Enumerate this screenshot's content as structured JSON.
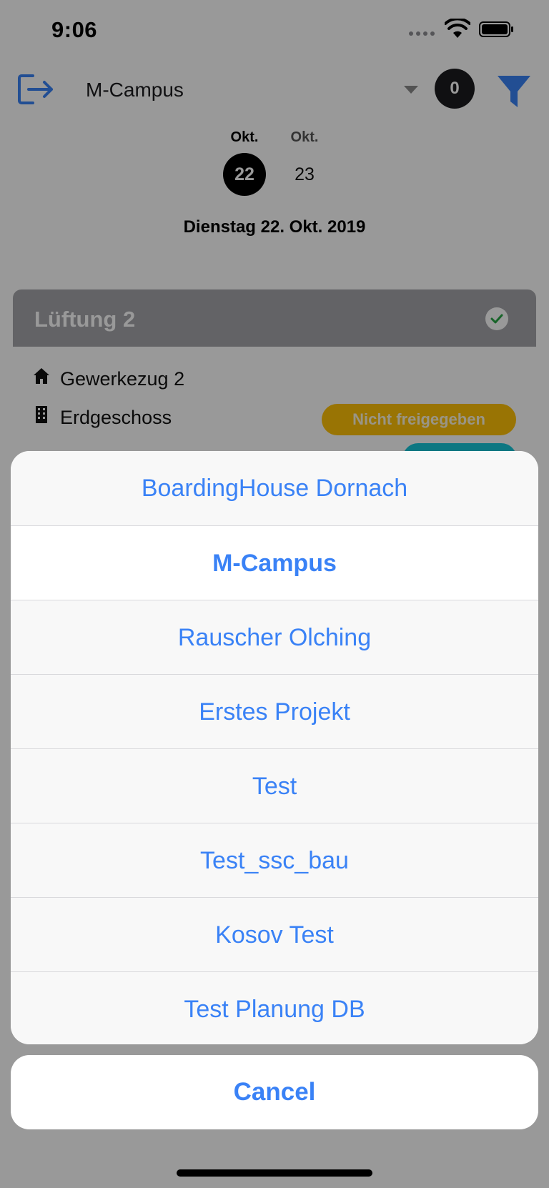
{
  "status_bar": {
    "time": "9:06"
  },
  "header": {
    "project_select_value": "M-Campus",
    "notification_count": "0",
    "dates": [
      {
        "month": "Okt.",
        "day": "22",
        "selected": true
      },
      {
        "month": "Okt.",
        "day": "23",
        "selected": false
      }
    ],
    "selected_date_label": "Dienstag 22. Okt. 2019"
  },
  "task_card": {
    "title": "Lüftung 2",
    "rows": [
      {
        "icon": "home-icon",
        "text": "Gewerkezug 2"
      },
      {
        "icon": "building-icon",
        "text": "Erdgeschoss"
      }
    ],
    "status_label": "Nicht freigegeben",
    "colors": {
      "header": "#a5a6ab",
      "status_pending": "#ffc107",
      "status_secondary": "#17c6d9"
    }
  },
  "action_sheet": {
    "options": [
      {
        "label": "BoardingHouse Dornach",
        "selected": false
      },
      {
        "label": "M-Campus",
        "selected": true
      },
      {
        "label": "Rauscher Olching",
        "selected": false
      },
      {
        "label": "Erstes Projekt",
        "selected": false
      },
      {
        "label": "Test",
        "selected": false
      },
      {
        "label": "Test_ssc_bau",
        "selected": false
      },
      {
        "label": "Kosov Test",
        "selected": false
      },
      {
        "label": "Test Planung DB",
        "selected": false
      }
    ],
    "cancel_label": "Cancel",
    "accent_color": "#3a82f6"
  }
}
